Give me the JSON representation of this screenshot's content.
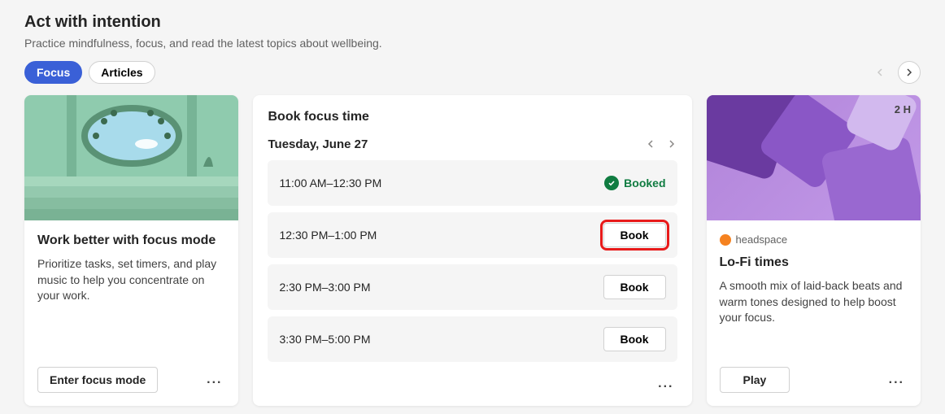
{
  "header": {
    "title": "Act with intention",
    "subtitle": "Practice mindfulness, focus, and read the latest topics about wellbeing.",
    "tabs": [
      {
        "label": "Focus",
        "active": true
      },
      {
        "label": "Articles",
        "active": false
      }
    ]
  },
  "focus_card": {
    "title": "Work better with focus mode",
    "description": "Prioritize tasks, set timers, and play music to help you concentrate on your work.",
    "cta": "Enter focus mode"
  },
  "book_card": {
    "title": "Book focus time",
    "date": "Tuesday, June 27",
    "slots": [
      {
        "time": "11:00 AM–12:30 PM",
        "status": "booked",
        "status_label": "Booked"
      },
      {
        "time": "12:30 PM–1:00 PM",
        "status": "available",
        "button_label": "Book",
        "highlight": true
      },
      {
        "time": "2:30 PM–3:00 PM",
        "status": "available",
        "button_label": "Book"
      },
      {
        "time": "3:30 PM–5:00 PM",
        "status": "available",
        "button_label": "Book"
      }
    ]
  },
  "headspace_card": {
    "brand": "headspace",
    "duration": "2 H",
    "title": "Lo-Fi times",
    "description": "A smooth mix of laid-back beats and warm tones designed to help boost your focus.",
    "cta": "Play"
  }
}
